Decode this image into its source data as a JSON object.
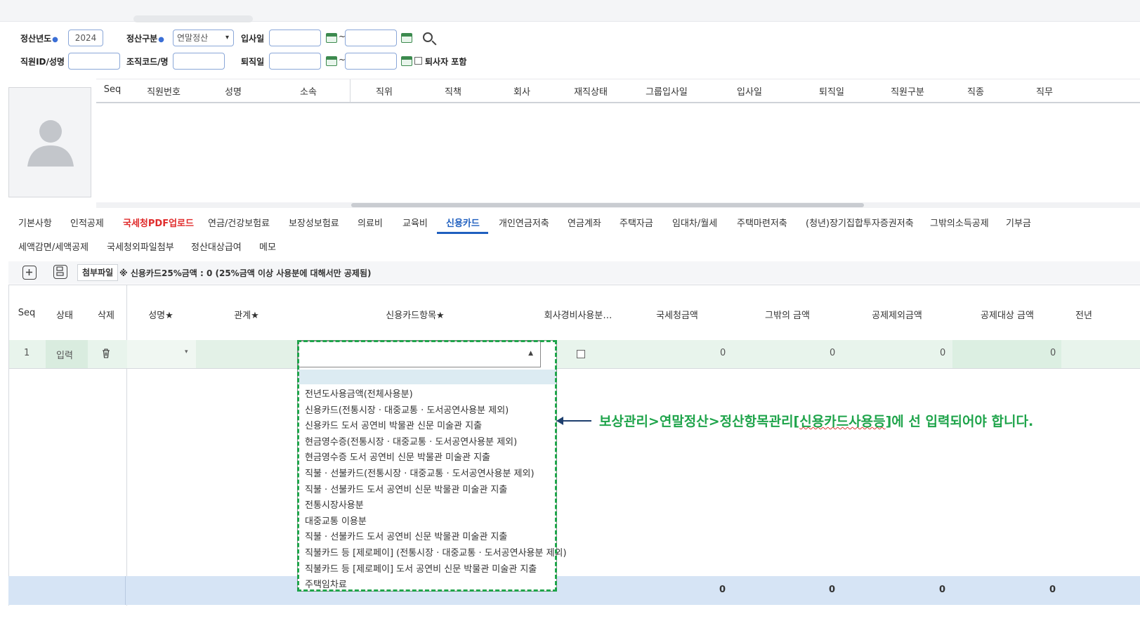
{
  "filters": {
    "year_label": "정산년도",
    "year_value": "2024",
    "type_label": "정산구분",
    "type_value": "연말정산",
    "hire_label": "입사일",
    "emp_label": "직원ID/성명",
    "org_label": "조직코드/명",
    "retire_label": "퇴직일",
    "tilde": "~",
    "include_retired": "퇴사자 포함"
  },
  "emp_grid": {
    "columns": [
      "Seq",
      "직원번호",
      "성명",
      "소속",
      "직위",
      "직책",
      "회사",
      "재직상태",
      "그룹입사일",
      "입사일",
      "퇴직일",
      "직원구분",
      "직종",
      "직무"
    ]
  },
  "tabs_row1": [
    "기본사항",
    "인적공제",
    "국세청PDF업로드",
    "연금/건강보험료",
    "보장성보험료",
    "의료비",
    "교육비",
    "신용카드",
    "개인연금저축",
    "연금계좌",
    "주택자금",
    "임대차/월세",
    "주택마련저축",
    "(청년)장기집합투자증권저축",
    "그밖의소득공제",
    "기부금"
  ],
  "tabs_row2": [
    "세액감면/세액공제",
    "국세청외파일첨부",
    "정산대상급여",
    "메모"
  ],
  "toolbar": {
    "attach_label": "첨부파일",
    "note": "※ 신용카드25%금액 : 0 (25%금액 이상 사용분에 대해서만 공제됨)"
  },
  "card_grid": {
    "columns": [
      "Seq",
      "상태",
      "삭제",
      "성명",
      "관계",
      "신용카드항목",
      "회사경비사용분…",
      "국세청금액",
      "그밖의 금액",
      "공제제외금액",
      "공제대상 금액",
      "전년"
    ],
    "row": {
      "seq": "1",
      "status": "입력",
      "amounts": [
        "0",
        "0",
        "0",
        "0"
      ]
    },
    "footer": [
      "0",
      "0",
      "0",
      "0"
    ]
  },
  "dropdown_options": [
    "전년도사용금액(전체사용분)",
    "신용카드(전통시장 · 대중교통 · 도서공연사용분 제외)",
    "신용카드 도서 공연비 박물관 신문 미술관 지출",
    "현금영수증(전통시장 · 대중교통 · 도서공연사용분 제외)",
    "현금영수증 도서 공연비 신문 박물관 미술관 지출",
    "직불 · 선불카드(전통시장 · 대중교통 · 도서공연사용분 제외)",
    "직불 · 선불카드 도서 공연비 신문 박물관 미술관 지출",
    "전통시장사용분",
    "대중교통 이용분",
    "직불 · 선불카드 도서 공연비 신문 박물관 미술관 지출",
    "직불카드 등 [제로페이] (전통시장 · 대중교통 · 도서공연사용분 제외)",
    "직불카드 등 [제로페이] 도서 공연비 신문 박물관 미술관 지출",
    "주택임차료"
  ],
  "callout": {
    "pre": "보상관리>연말정산>정산항목관리[",
    "mid": "신용카드사용등",
    "post": "]에 선 입력되어야 합니다."
  },
  "colors": {
    "accent": "#1f5fbf",
    "callout": "#1fa44b",
    "active_row": "#e8f4ec",
    "footer": "#d6e4f5",
    "red_tab": "#e02b2b"
  }
}
